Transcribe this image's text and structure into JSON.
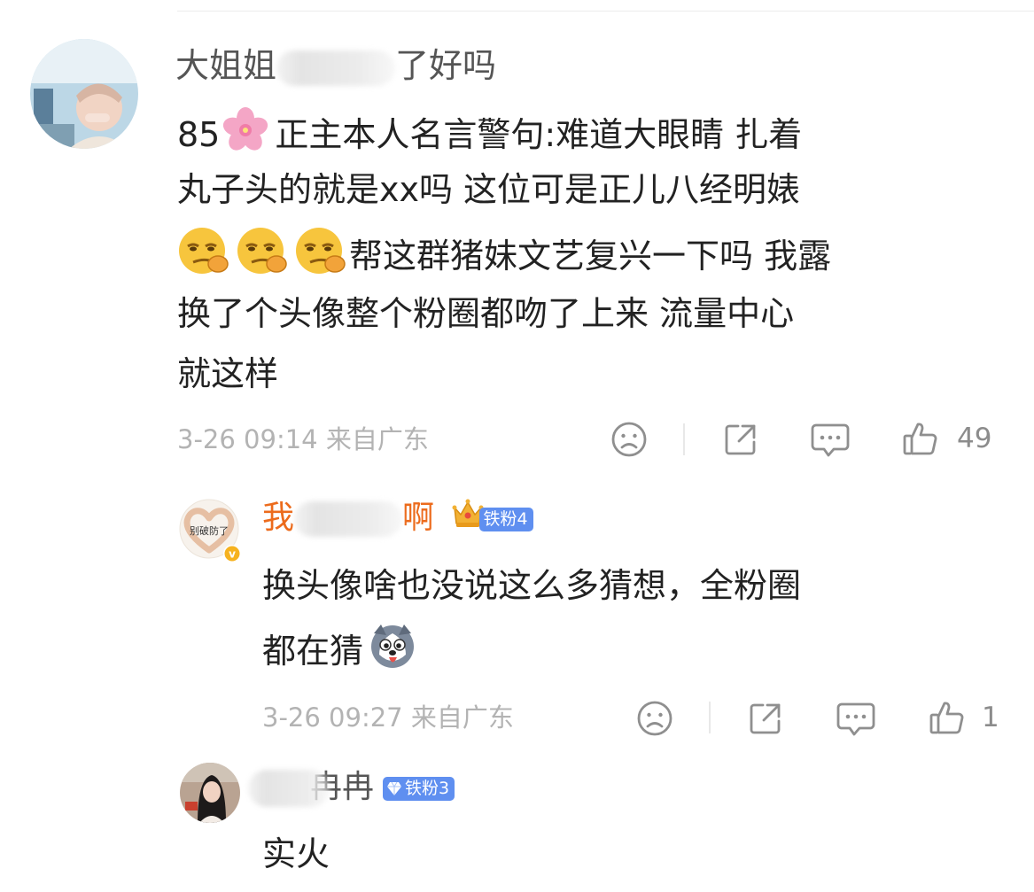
{
  "colors": {
    "username_orange": "#ec6b1c",
    "meta_gray": "#b3b3b3",
    "count_gray": "#8c8c8c",
    "badge_blue": "#5f8ff0",
    "crown_gold": "#f2b134"
  },
  "comments": [
    {
      "author_visible_start": "大姐姐",
      "author_visible_end": "了好吗",
      "author_partially_obscured": true,
      "text_prefix": "85",
      "text_line1_rest": "正主本人名言警句:难道大眼睛 扎着",
      "text_line2": "丸子头的就是xx吗 这位可是正儿八经明婊",
      "text_line3_rest": "帮这群猪妹文艺复兴一下吗 我露",
      "text_line4": "换了个头像整个粉圈都吻了上来 流量中心",
      "text_line5": "就这样",
      "emojis": [
        "cherry-blossom-emoji",
        "smirk-emoji",
        "smirk-emoji",
        "smirk-emoji"
      ],
      "date": "3-26",
      "time": "09:14",
      "location": "来自广东",
      "likes": "49"
    },
    {
      "author_visible_start": "我",
      "author_visible_end": "啊",
      "author_partially_obscured": true,
      "avatar_text": "别破防了",
      "badge": "铁粉4",
      "text_line1": "换头像啥也没说这么多猜想，全粉圈",
      "text_line2": "都在猜",
      "emojis": [
        "husky-emoji"
      ],
      "date": "3-26",
      "time": "09:27",
      "location": "来自广东",
      "likes": "1"
    },
    {
      "author_visible_end": "冉冉",
      "author_partially_obscured": true,
      "badge": "铁粉3",
      "text": "实火"
    }
  ],
  "icons": {
    "dislike": "sad-face-icon",
    "share": "share-icon",
    "comment": "comment-icon",
    "like": "thumb-up-icon",
    "crown": "crown-icon",
    "diamond": "diamond-icon",
    "verified": "verified-icon"
  }
}
